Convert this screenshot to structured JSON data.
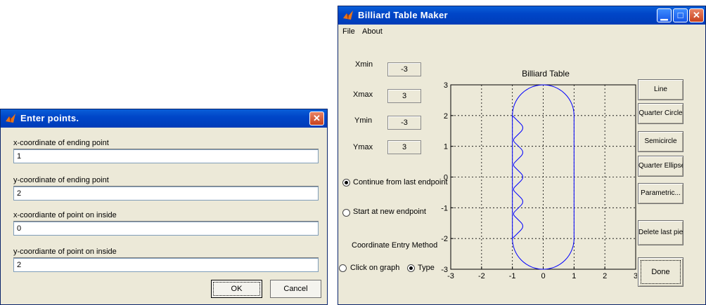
{
  "dialog": {
    "title": "Enter points.",
    "fields": [
      {
        "label": "x-coordinate of ending point",
        "value": "1"
      },
      {
        "label": "y-coordinate of ending point",
        "value": "2"
      },
      {
        "label": "x-coordiante of point on inside",
        "value": "0"
      },
      {
        "label": "y-coordiante of point on inside",
        "value": "2"
      }
    ],
    "ok_label": "OK",
    "cancel_label": "Cancel"
  },
  "main": {
    "title": "Billiard Table Maker",
    "menu": [
      "File",
      "About"
    ],
    "limits": [
      {
        "label": "Xmin",
        "value": "-3"
      },
      {
        "label": "Xmax",
        "value": "3"
      },
      {
        "label": "Ymin",
        "value": "-3"
      },
      {
        "label": "Ymax",
        "value": "3"
      }
    ],
    "radio_continue": "Continue from last endpoint",
    "radio_start": "Start at new endpoint",
    "entry_method_label": "Coordinate Entry Method",
    "radio_click": "Click on graph",
    "radio_type": "Type",
    "buttons": {
      "line": "Line",
      "quarter_circle": "Quarter Circle",
      "semicircle": "Semicircle",
      "quarter_ellipse": "Quarter Ellipse",
      "parametric": "Parametric...",
      "delete_last": "Delete last piece",
      "done": "Done"
    },
    "colors": {
      "titlebar": "#0046c8",
      "curve": "#0000ff"
    }
  },
  "chart_data": {
    "type": "line",
    "title": "Billiard Table",
    "xlim": [
      -3,
      3
    ],
    "ylim": [
      -3,
      3
    ],
    "x_ticks": [
      "-3",
      "-2",
      "-1",
      "0",
      "1",
      "2",
      "3"
    ],
    "y_ticks": [
      "-3",
      "-2",
      "-1",
      "0",
      "1",
      "2",
      "3"
    ],
    "grid": true,
    "series": [
      {
        "x": [
          -1,
          -1
        ],
        "y": [
          -2,
          2
        ]
      },
      {
        "x": [
          1,
          1
        ],
        "y": [
          -2,
          2
        ]
      },
      {
        "x": [
          -1,
          -0.707,
          0,
          0.707,
          1
        ],
        "y": [
          2,
          2.707,
          3,
          2.707,
          2
        ]
      },
      {
        "x": [
          -1,
          -0.707,
          0,
          0.707,
          1
        ],
        "y": [
          -2,
          -2.707,
          -3,
          -2.707,
          -2
        ]
      },
      {
        "x": [
          -1,
          -0.85,
          -0.6,
          -0.85,
          -1,
          -0.85,
          -0.6,
          -0.85,
          -1,
          -0.85,
          -0.6,
          -0.85,
          -1,
          -0.85,
          -0.6,
          -0.85,
          -1,
          -0.85,
          -0.6,
          -0.85,
          -1
        ],
        "y": [
          2,
          1.85,
          1.6,
          1.35,
          1.2,
          1.05,
          0.8,
          0.55,
          0.4,
          0.25,
          0,
          -0.25,
          -0.4,
          -0.55,
          -0.8,
          -1.05,
          -1.2,
          -1.35,
          -1.6,
          -1.85,
          -2
        ]
      }
    ]
  }
}
